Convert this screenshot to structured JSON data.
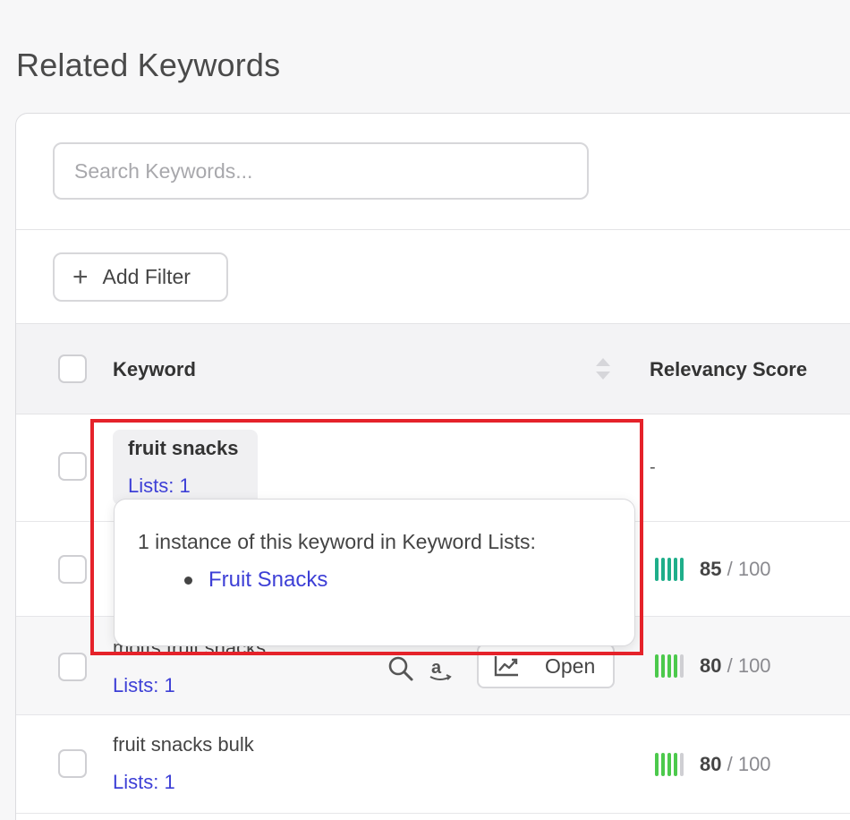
{
  "page": {
    "title": "Related Keywords"
  },
  "search": {
    "placeholder": "Search Keywords..."
  },
  "filters": {
    "add_label": "Add Filter"
  },
  "table": {
    "headers": {
      "keyword": "Keyword",
      "relevancy": "Relevancy Score"
    },
    "rows": [
      {
        "keyword": "fruit snacks",
        "lists": "Lists: 1",
        "score_text": "-"
      },
      {
        "keyword": "",
        "lists": "",
        "score": "85",
        "score_max": "/ 100",
        "bars_filled": 5,
        "bar_color": "#1fae8a"
      },
      {
        "keyword": "motts fruit snacks",
        "lists": "Lists: 1",
        "score": "80",
        "score_max": "/ 100",
        "bars_filled": 4,
        "bar_color": "#4cc94c",
        "open_label": "Open"
      },
      {
        "keyword": "fruit snacks bulk",
        "lists": "Lists: 1",
        "score": "80",
        "score_max": "/ 100",
        "bars_filled": 4,
        "bar_color": "#4cc94c"
      }
    ]
  },
  "popover": {
    "title": "1 instance of this keyword in Keyword Lists:",
    "items": [
      "Fruit Snacks"
    ]
  },
  "colors": {
    "link": "#3d3fd6",
    "highlight": "#e5222a",
    "bar_empty": "#cfcfd3"
  },
  "icons": {
    "add": "plus-icon",
    "sort": "sort-icon",
    "search": "magnifier-icon",
    "amazon": "amazon-icon",
    "chart": "trend-chart-icon"
  }
}
